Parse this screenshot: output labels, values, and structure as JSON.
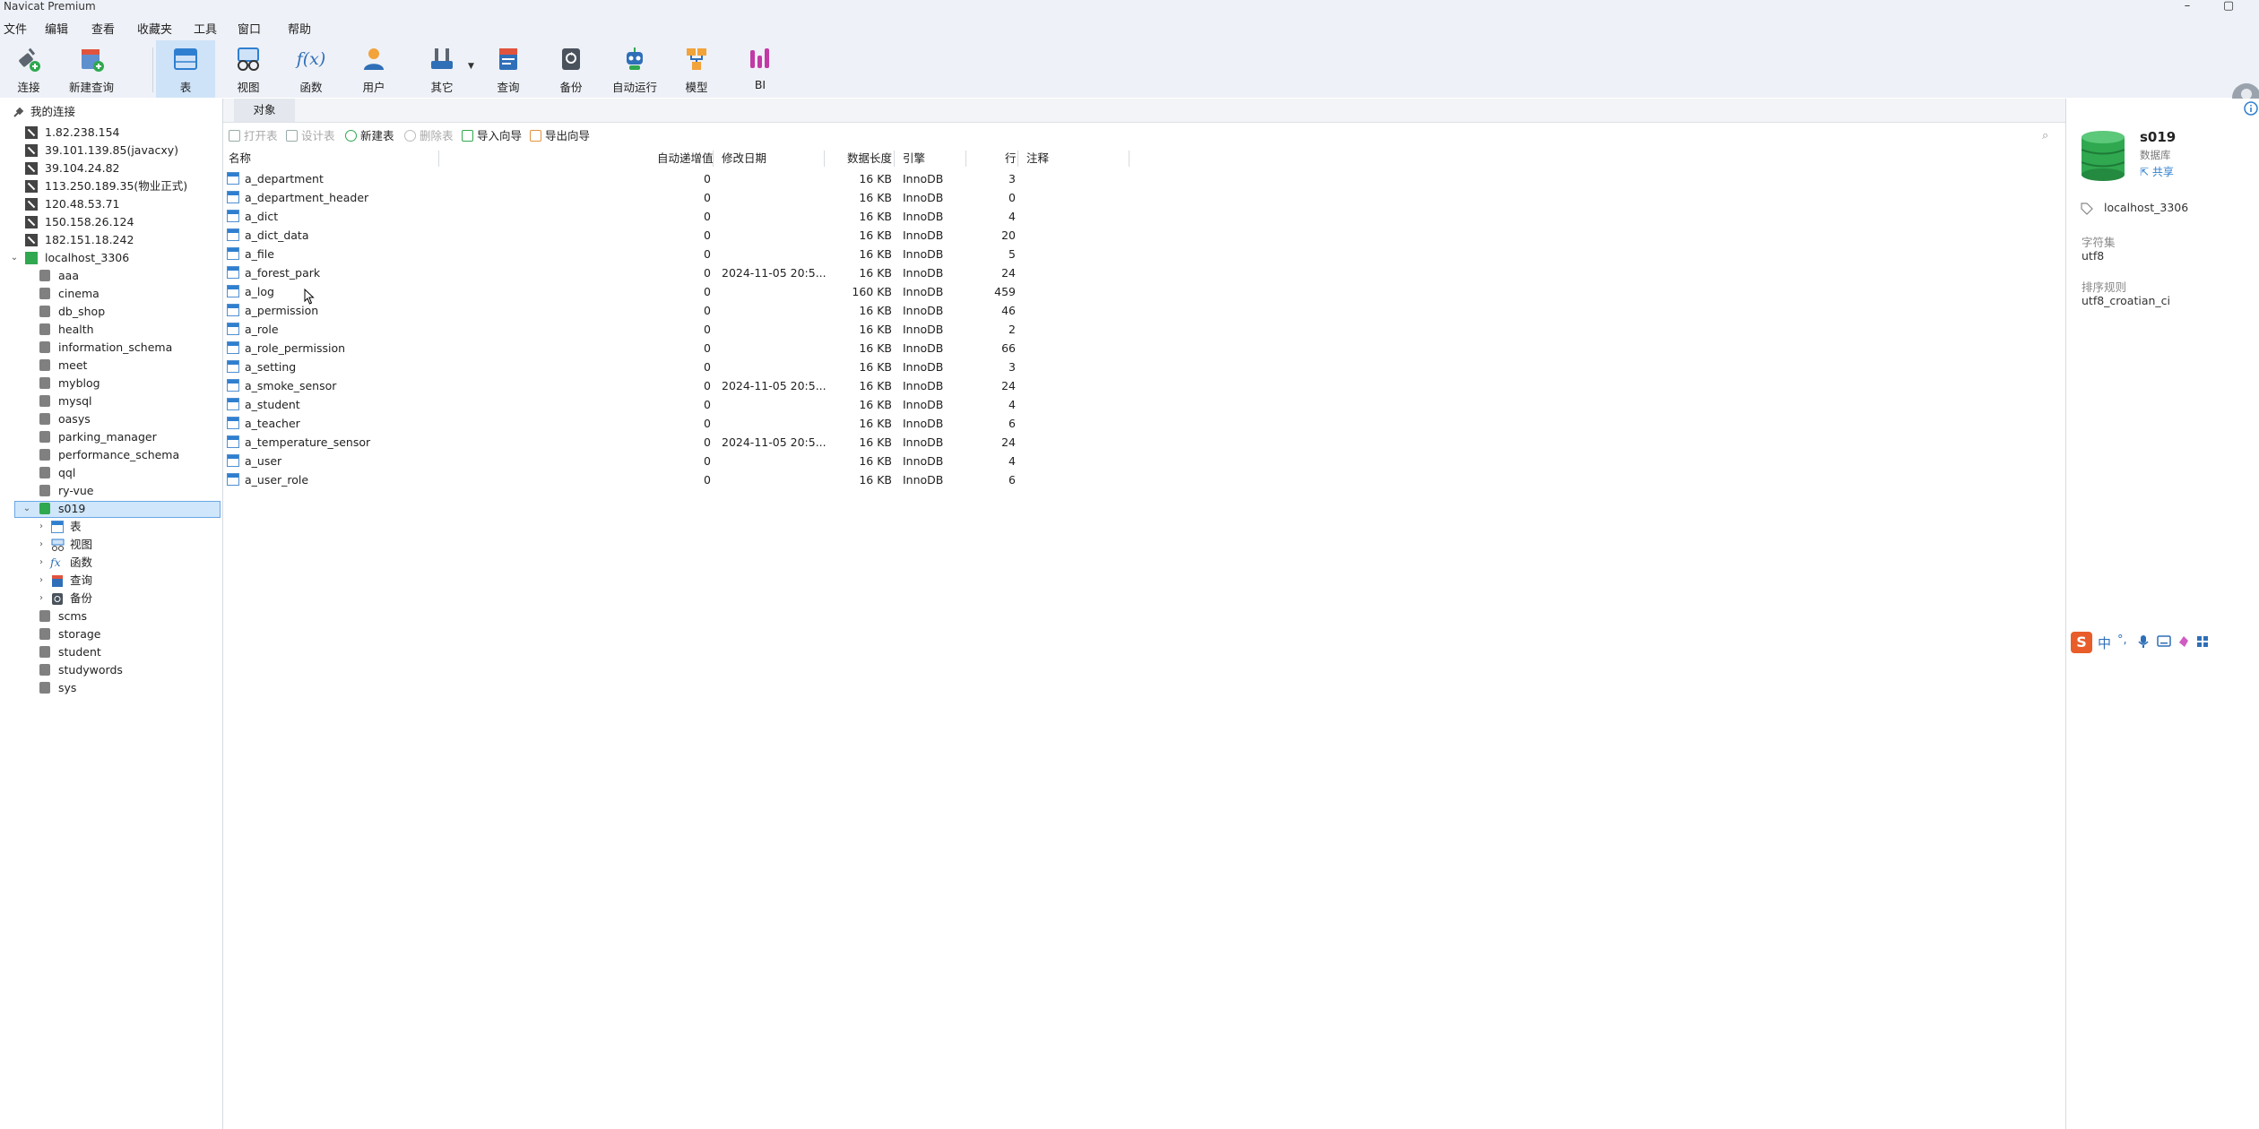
{
  "window": {
    "title": "Navicat Premium",
    "min_glyph": "–",
    "max_glyph": "▢"
  },
  "menu": [
    "文件",
    "编辑",
    "查看",
    "收藏夹",
    "工具",
    "窗口",
    "帮助"
  ],
  "toolbar": {
    "items": [
      {
        "label": "连接",
        "icon": "plug-icon"
      },
      {
        "label": "新建查询",
        "icon": "new-query-icon"
      },
      {
        "label": "表",
        "icon": "table-icon"
      },
      {
        "label": "视图",
        "icon": "view-icon"
      },
      {
        "label": "函数",
        "icon": "function-icon",
        "glyph": "f(x)"
      },
      {
        "label": "用户",
        "icon": "user-icon"
      },
      {
        "label": "其它",
        "icon": "tools-icon"
      },
      {
        "label": "查询",
        "icon": "query-icon"
      },
      {
        "label": "备份",
        "icon": "backup-icon"
      },
      {
        "label": "自动运行",
        "icon": "robot-icon"
      },
      {
        "label": "模型",
        "icon": "model-icon"
      },
      {
        "label": "BI",
        "icon": "bi-icon"
      }
    ],
    "active": "表"
  },
  "sidebar": {
    "root_label": "我的连接",
    "connections": [
      "1.82.238.154",
      "39.101.139.85(javacxy)",
      "39.104.24.82",
      "113.250.189.35(物业正式)",
      "120.48.53.71",
      "150.158.26.124",
      "182.151.18.242"
    ],
    "local": "localhost_3306",
    "databases_before": [
      "aaa",
      "cinema",
      "db_shop",
      "health",
      "information_schema",
      "meet",
      "myblog",
      "mysql",
      "oasys",
      "parking_manager",
      "performance_schema",
      "qql",
      "ry-vue"
    ],
    "selected_db": "s019",
    "s019_children": [
      {
        "label": "表",
        "icon": "table-icon"
      },
      {
        "label": "视图",
        "icon": "view-icon"
      },
      {
        "label": "函数",
        "icon": "function-icon"
      },
      {
        "label": "查询",
        "icon": "query-icon"
      },
      {
        "label": "备份",
        "icon": "backup-icon"
      }
    ],
    "databases_after": [
      "scms",
      "storage",
      "student",
      "studywords",
      "sys"
    ]
  },
  "tabs": {
    "objects": "对象"
  },
  "object_toolbar": {
    "open": "打开表",
    "design": "设计表",
    "new": "新建表",
    "delete": "删除表",
    "import": "导入向导",
    "export": "导出向导"
  },
  "table": {
    "headers": {
      "name": "名称",
      "auto_inc": "自动递增值",
      "modified": "修改日期",
      "data_len": "数据长度",
      "engine": "引擎",
      "rows": "行",
      "comment": "注释"
    },
    "rows": [
      {
        "name": "a_department",
        "auto_inc": "0",
        "modified": "",
        "data_len": "16 KB",
        "engine": "InnoDB",
        "rows": "3"
      },
      {
        "name": "a_department_header",
        "auto_inc": "0",
        "modified": "",
        "data_len": "16 KB",
        "engine": "InnoDB",
        "rows": "0"
      },
      {
        "name": "a_dict",
        "auto_inc": "0",
        "modified": "",
        "data_len": "16 KB",
        "engine": "InnoDB",
        "rows": "4"
      },
      {
        "name": "a_dict_data",
        "auto_inc": "0",
        "modified": "",
        "data_len": "16 KB",
        "engine": "InnoDB",
        "rows": "20"
      },
      {
        "name": "a_file",
        "auto_inc": "0",
        "modified": "",
        "data_len": "16 KB",
        "engine": "InnoDB",
        "rows": "5"
      },
      {
        "name": "a_forest_park",
        "auto_inc": "0",
        "modified": "2024-11-05 20:5...",
        "data_len": "16 KB",
        "engine": "InnoDB",
        "rows": "24"
      },
      {
        "name": "a_log",
        "auto_inc": "0",
        "modified": "",
        "data_len": "160 KB",
        "engine": "InnoDB",
        "rows": "459"
      },
      {
        "name": "a_permission",
        "auto_inc": "0",
        "modified": "",
        "data_len": "16 KB",
        "engine": "InnoDB",
        "rows": "46"
      },
      {
        "name": "a_role",
        "auto_inc": "0",
        "modified": "",
        "data_len": "16 KB",
        "engine": "InnoDB",
        "rows": "2"
      },
      {
        "name": "a_role_permission",
        "auto_inc": "0",
        "modified": "",
        "data_len": "16 KB",
        "engine": "InnoDB",
        "rows": "66"
      },
      {
        "name": "a_setting",
        "auto_inc": "0",
        "modified": "",
        "data_len": "16 KB",
        "engine": "InnoDB",
        "rows": "3"
      },
      {
        "name": "a_smoke_sensor",
        "auto_inc": "0",
        "modified": "2024-11-05 20:5...",
        "data_len": "16 KB",
        "engine": "InnoDB",
        "rows": "24"
      },
      {
        "name": "a_student",
        "auto_inc": "0",
        "modified": "",
        "data_len": "16 KB",
        "engine": "InnoDB",
        "rows": "4"
      },
      {
        "name": "a_teacher",
        "auto_inc": "0",
        "modified": "",
        "data_len": "16 KB",
        "engine": "InnoDB",
        "rows": "6"
      },
      {
        "name": "a_temperature_sensor",
        "auto_inc": "0",
        "modified": "2024-11-05 20:5...",
        "data_len": "16 KB",
        "engine": "InnoDB",
        "rows": "24"
      },
      {
        "name": "a_user",
        "auto_inc": "0",
        "modified": "",
        "data_len": "16 KB",
        "engine": "InnoDB",
        "rows": "4"
      },
      {
        "name": "a_user_role",
        "auto_inc": "0",
        "modified": "",
        "data_len": "16 KB",
        "engine": "InnoDB",
        "rows": "6"
      }
    ]
  },
  "info_panel": {
    "name": "s019",
    "type": "数据库",
    "share": "共享",
    "connection": "localhost_3306",
    "charset_label": "字符集",
    "charset": "utf8",
    "collation_label": "排序规则",
    "collation": "utf8_croatian_ci"
  },
  "ime": {
    "logo": "S",
    "lang": "中"
  },
  "colors": {
    "accent": "#2f7fd0",
    "selection": "#cfe6fb",
    "db_green": "#2fa84f",
    "bg_chrome": "#eef1f7"
  }
}
